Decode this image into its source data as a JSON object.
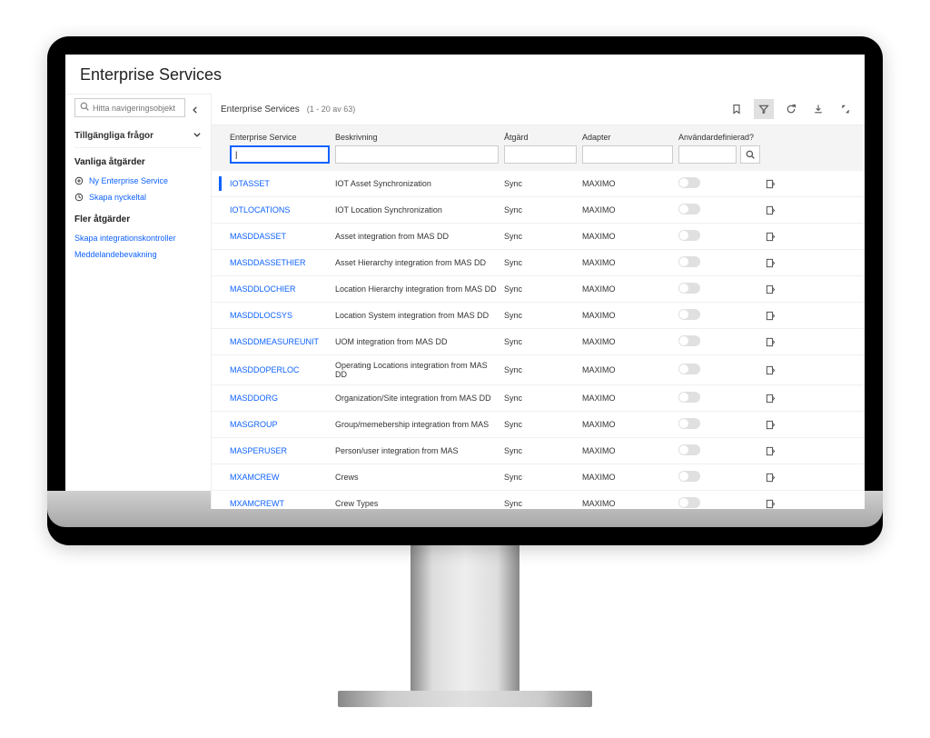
{
  "page_title": "Enterprise Services",
  "sidebar": {
    "search_placeholder": "Hitta navigeringsobjekt",
    "dropdown_label": "Tillgängliga frågor",
    "section_common": "Vanliga åtgärder",
    "section_more": "Fler åtgärder",
    "common_items": [
      {
        "icon": "plus-circle",
        "label": "Ny Enterprise Service"
      },
      {
        "icon": "clock",
        "label": "Skapa nyckeltal"
      }
    ],
    "more_items": [
      {
        "label": "Skapa integrationskontroller"
      },
      {
        "label": "Meddelandebevakning"
      }
    ]
  },
  "content": {
    "list_title": "Enterprise Services",
    "pagination": "(1 - 20 av 63)",
    "columns": {
      "service": "Enterprise Service",
      "description": "Beskrivning",
      "action": "Åtgärd",
      "adapter": "Adapter",
      "userdef": "Användardefinierad?"
    },
    "rows": [
      {
        "service": "IOTASSET",
        "description": "IOT Asset Synchronization",
        "action": "Sync",
        "adapter": "MAXIMO",
        "selected": true
      },
      {
        "service": "IOTLOCATIONS",
        "description": "IOT Location Synchronization",
        "action": "Sync",
        "adapter": "MAXIMO"
      },
      {
        "service": "MASDDASSET",
        "description": "Asset integration from MAS DD",
        "action": "Sync",
        "adapter": "MAXIMO"
      },
      {
        "service": "MASDDASSETHIER",
        "description": "Asset Hierarchy integration from MAS DD",
        "action": "Sync",
        "adapter": "MAXIMO"
      },
      {
        "service": "MASDDLOCHIER",
        "description": "Location Hierarchy integration from MAS DD",
        "action": "Sync",
        "adapter": "MAXIMO"
      },
      {
        "service": "MASDDLOCSYS",
        "description": "Location System integration from MAS DD",
        "action": "Sync",
        "adapter": "MAXIMO"
      },
      {
        "service": "MASDDMEASUREUNIT",
        "description": "UOM integration from MAS DD",
        "action": "Sync",
        "adapter": "MAXIMO"
      },
      {
        "service": "MASDDOPERLOC",
        "description": "Operating Locations integration from MAS DD",
        "action": "Sync",
        "adapter": "MAXIMO"
      },
      {
        "service": "MASDDORG",
        "description": "Organization/Site integration from MAS DD",
        "action": "Sync",
        "adapter": "MAXIMO"
      },
      {
        "service": "MASGROUP",
        "description": "Group/memebership integration from MAS",
        "action": "Sync",
        "adapter": "MAXIMO"
      },
      {
        "service": "MASPERUSER",
        "description": "Person/user integration from MAS",
        "action": "Sync",
        "adapter": "MAXIMO"
      },
      {
        "service": "MXAMCREW",
        "description": "Crews",
        "action": "Sync",
        "adapter": "MAXIMO"
      },
      {
        "service": "MXAMCREWT",
        "description": "Crew Types",
        "action": "Sync",
        "adapter": "MAXIMO"
      }
    ]
  }
}
